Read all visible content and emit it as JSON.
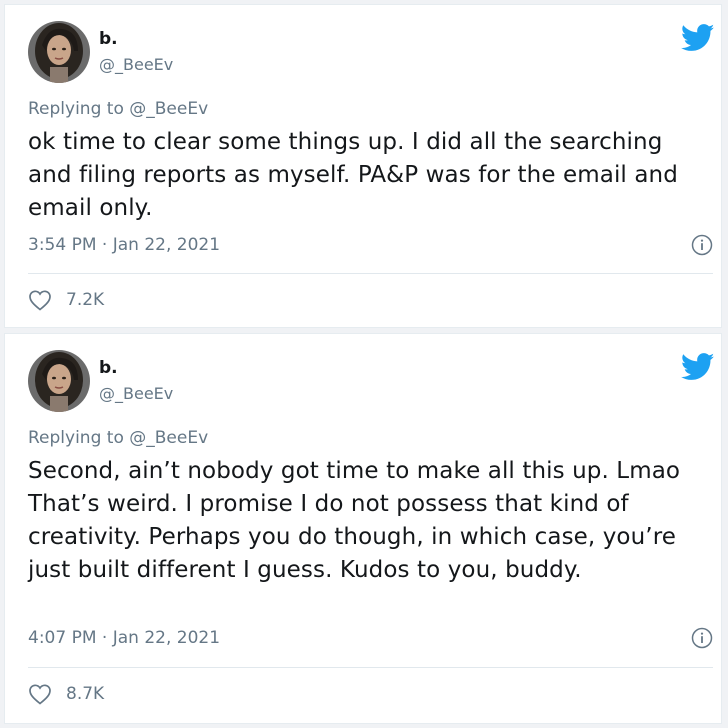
{
  "tweets": [
    {
      "display_name": "b.",
      "handle": "@_BeeEv",
      "replying_to": "Replying to @_BeeEv",
      "text": "ok time to clear some things up.  I did all the searching and filing reports as myself. PA&P was for the email and email only.",
      "timestamp": "3:54 PM · Jan 22, 2021",
      "likes": "7.2K"
    },
    {
      "display_name": "b.",
      "handle": "@_BeeEv",
      "replying_to": "Replying to @_BeeEv",
      "text": "Second, ain’t nobody got time to make all this up. Lmao That’s weird. I promise I do not possess that kind of creativity. Perhaps  you do though, in which case, you’re just built different I guess. Kudos to you, buddy.",
      "timestamp": "4:07 PM · Jan 22, 2021",
      "likes": "8.7K"
    }
  ],
  "icons": {
    "brand": "twitter-bird-icon",
    "info": "info-icon",
    "like": "heart-icon"
  },
  "colors": {
    "twitter_blue": "#1da1f2",
    "text_primary": "#14171a",
    "text_secondary": "#657786",
    "divider": "#e1e8ed"
  }
}
